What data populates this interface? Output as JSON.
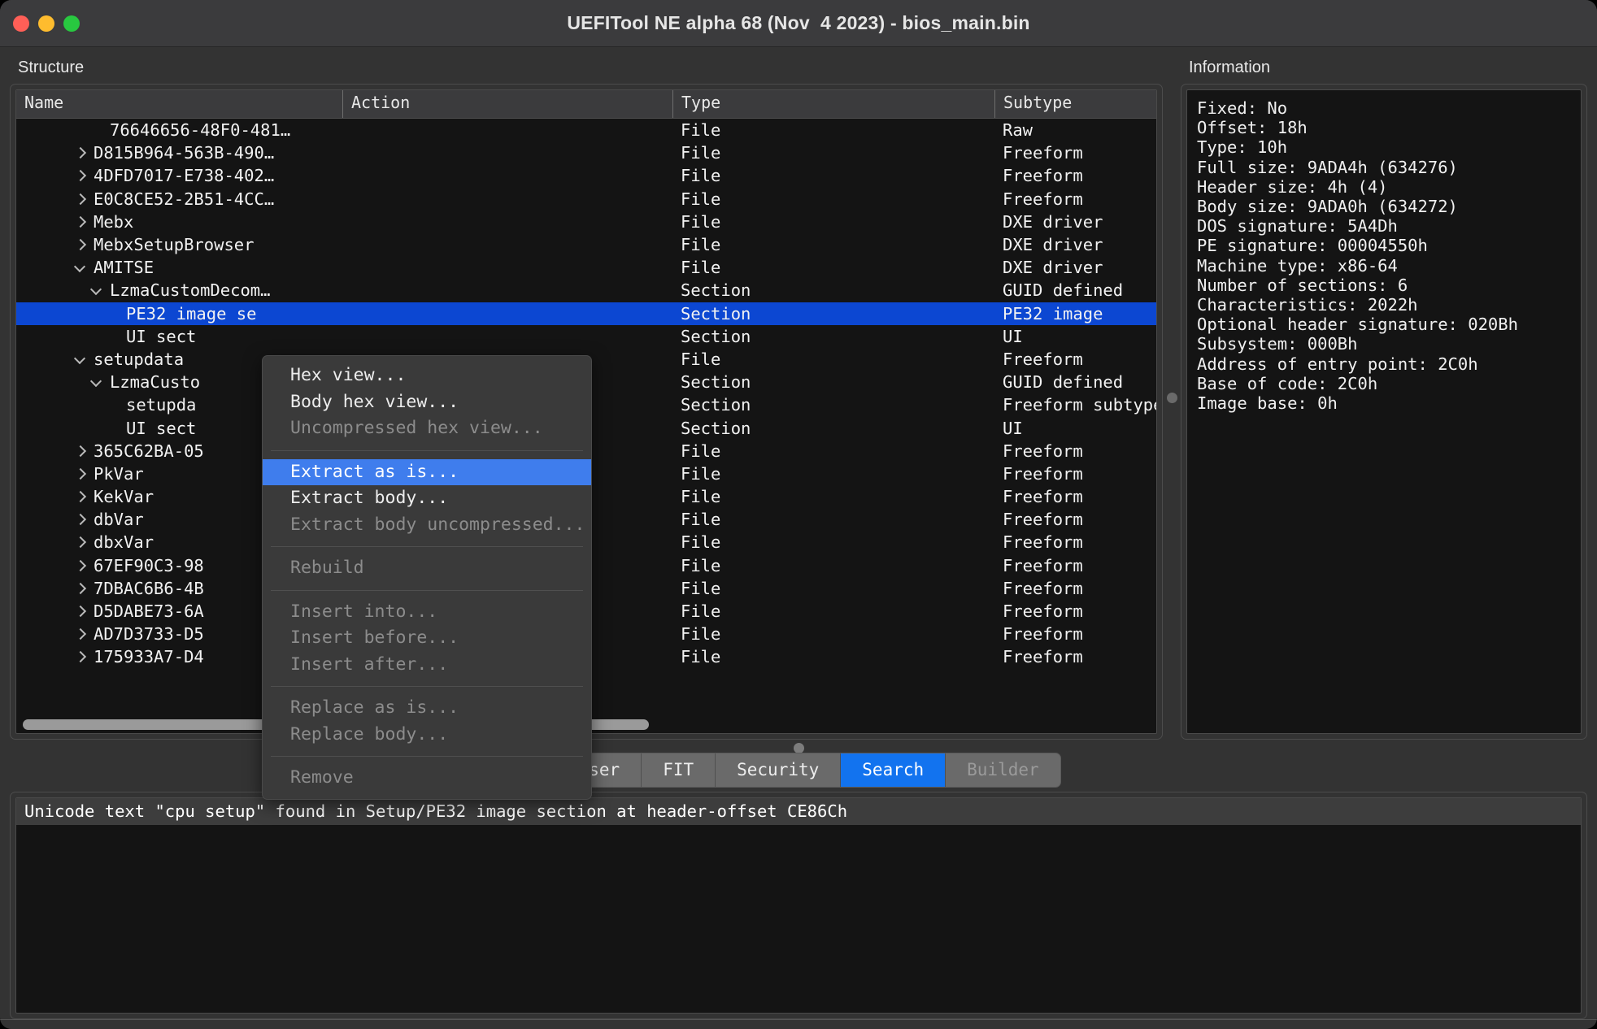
{
  "window": {
    "title": "UEFITool NE alpha 68 (Nov  4 2023) - bios_main.bin",
    "traffic_lights": [
      "close-button",
      "minimize-button",
      "zoom-button"
    ]
  },
  "structure": {
    "label": "Structure",
    "columns": [
      "Name",
      "Action",
      "Type",
      "Subtype"
    ],
    "rows": [
      {
        "name": "76646656-48F0-481…",
        "indent": 4,
        "arrow": "none",
        "action": "",
        "type": "File",
        "subtype": "Raw"
      },
      {
        "name": "D815B964-563B-490…",
        "indent": 3,
        "arrow": "closed",
        "action": "",
        "type": "File",
        "subtype": "Freeform"
      },
      {
        "name": "4DFD7017-E738-402…",
        "indent": 3,
        "arrow": "closed",
        "action": "",
        "type": "File",
        "subtype": "Freeform"
      },
      {
        "name": "E0C8CE52-2B51-4CC…",
        "indent": 3,
        "arrow": "closed",
        "action": "",
        "type": "File",
        "subtype": "Freeform"
      },
      {
        "name": "Mebx",
        "indent": 3,
        "arrow": "closed",
        "action": "",
        "type": "File",
        "subtype": "DXE driver"
      },
      {
        "name": "MebxSetupBrowser",
        "indent": 3,
        "arrow": "closed",
        "action": "",
        "type": "File",
        "subtype": "DXE driver"
      },
      {
        "name": "AMITSE",
        "indent": 3,
        "arrow": "open",
        "action": "",
        "type": "File",
        "subtype": "DXE driver"
      },
      {
        "name": "LzmaCustomDecom…",
        "indent": 4,
        "arrow": "open",
        "action": "",
        "type": "Section",
        "subtype": "GUID defined"
      },
      {
        "name": "PE32 image se",
        "indent": 5,
        "arrow": "none",
        "action": "",
        "type": "Section",
        "subtype": "PE32 image",
        "selected": true
      },
      {
        "name": "UI sect",
        "indent": 5,
        "arrow": "none",
        "action": "",
        "type": "Section",
        "subtype": "UI"
      },
      {
        "name": "setupdata",
        "indent": 3,
        "arrow": "open",
        "action": "",
        "type": "File",
        "subtype": "Freeform"
      },
      {
        "name": "LzmaCusto",
        "indent": 4,
        "arrow": "open",
        "action": "",
        "type": "Section",
        "subtype": "GUID defined"
      },
      {
        "name": "setupda",
        "indent": 5,
        "arrow": "none",
        "action": "",
        "type": "Section",
        "subtype": "Freeform subtype"
      },
      {
        "name": "UI sect",
        "indent": 5,
        "arrow": "none",
        "action": "",
        "type": "Section",
        "subtype": "UI"
      },
      {
        "name": "365C62BA-05",
        "indent": 3,
        "arrow": "closed",
        "action": "",
        "type": "File",
        "subtype": "Freeform"
      },
      {
        "name": "PkVar",
        "indent": 3,
        "arrow": "closed",
        "action": "",
        "type": "File",
        "subtype": "Freeform"
      },
      {
        "name": "KekVar",
        "indent": 3,
        "arrow": "closed",
        "action": "",
        "type": "File",
        "subtype": "Freeform"
      },
      {
        "name": "dbVar",
        "indent": 3,
        "arrow": "closed",
        "action": "",
        "type": "File",
        "subtype": "Freeform"
      },
      {
        "name": "dbxVar",
        "indent": 3,
        "arrow": "closed",
        "action": "",
        "type": "File",
        "subtype": "Freeform"
      },
      {
        "name": "67EF90C3-98",
        "indent": 3,
        "arrow": "closed",
        "action": "",
        "type": "File",
        "subtype": "Freeform"
      },
      {
        "name": "7DBAC6B6-4B",
        "indent": 3,
        "arrow": "closed",
        "action": "",
        "type": "File",
        "subtype": "Freeform"
      },
      {
        "name": "D5DABE73-6A",
        "indent": 3,
        "arrow": "closed",
        "action": "",
        "type": "File",
        "subtype": "Freeform"
      },
      {
        "name": "AD7D3733-D5",
        "indent": 3,
        "arrow": "closed",
        "action": "",
        "type": "File",
        "subtype": "Freeform"
      },
      {
        "name": "175933A7-D4",
        "indent": 3,
        "arrow": "closed",
        "action": "",
        "type": "File",
        "subtype": "Freeform"
      }
    ]
  },
  "information": {
    "label": "Information",
    "lines": [
      "Fixed: No",
      "Offset: 18h",
      "Type: 10h",
      "Full size: 9ADA4h (634276)",
      "Header size: 4h (4)",
      "Body size: 9ADA0h (634272)",
      "DOS signature: 5A4Dh",
      "PE signature: 00004550h",
      "Machine type: x86-64",
      "Number of sections: 6",
      "Characteristics: 2022h",
      "Optional header signature: 020Bh",
      "Subsystem: 000Bh",
      "Address of entry point: 2C0h",
      "Base of code: 2C0h",
      "Image base: 0h"
    ]
  },
  "context_menu": {
    "items": [
      {
        "label": "Hex view...",
        "state": "enabled"
      },
      {
        "label": "Body hex view...",
        "state": "enabled"
      },
      {
        "label": "Uncompressed hex view...",
        "state": "disabled"
      },
      {
        "separator": true
      },
      {
        "label": "Extract as is...",
        "state": "highlighted"
      },
      {
        "label": "Extract body...",
        "state": "enabled"
      },
      {
        "label": "Extract body uncompressed...",
        "state": "disabled"
      },
      {
        "separator": true
      },
      {
        "label": "Rebuild",
        "state": "disabled"
      },
      {
        "separator": true
      },
      {
        "label": "Insert into...",
        "state": "disabled"
      },
      {
        "label": "Insert before...",
        "state": "disabled"
      },
      {
        "label": "Insert after...",
        "state": "disabled"
      },
      {
        "separator": true
      },
      {
        "label": "Replace as is...",
        "state": "disabled"
      },
      {
        "label": "Replace body...",
        "state": "disabled"
      },
      {
        "separator": true
      },
      {
        "label": "Remove",
        "state": "disabled"
      }
    ]
  },
  "tabs": [
    {
      "label": "Parser",
      "state": "enabled"
    },
    {
      "label": "FIT",
      "state": "enabled"
    },
    {
      "label": "Security",
      "state": "enabled"
    },
    {
      "label": "Search",
      "state": "active"
    },
    {
      "label": "Builder",
      "state": "disabled"
    }
  ],
  "output": {
    "selected_line": "Unicode text \"cpu setup\" found in Setup/PE32 image section at header-offset CE86Ch"
  },
  "colors": {
    "selection_blue": "#0c47d2",
    "menu_highlight_blue": "#3f7ded",
    "tab_active_blue": "#1273ef",
    "panel_bg": "#333333",
    "view_bg": "#141414"
  }
}
